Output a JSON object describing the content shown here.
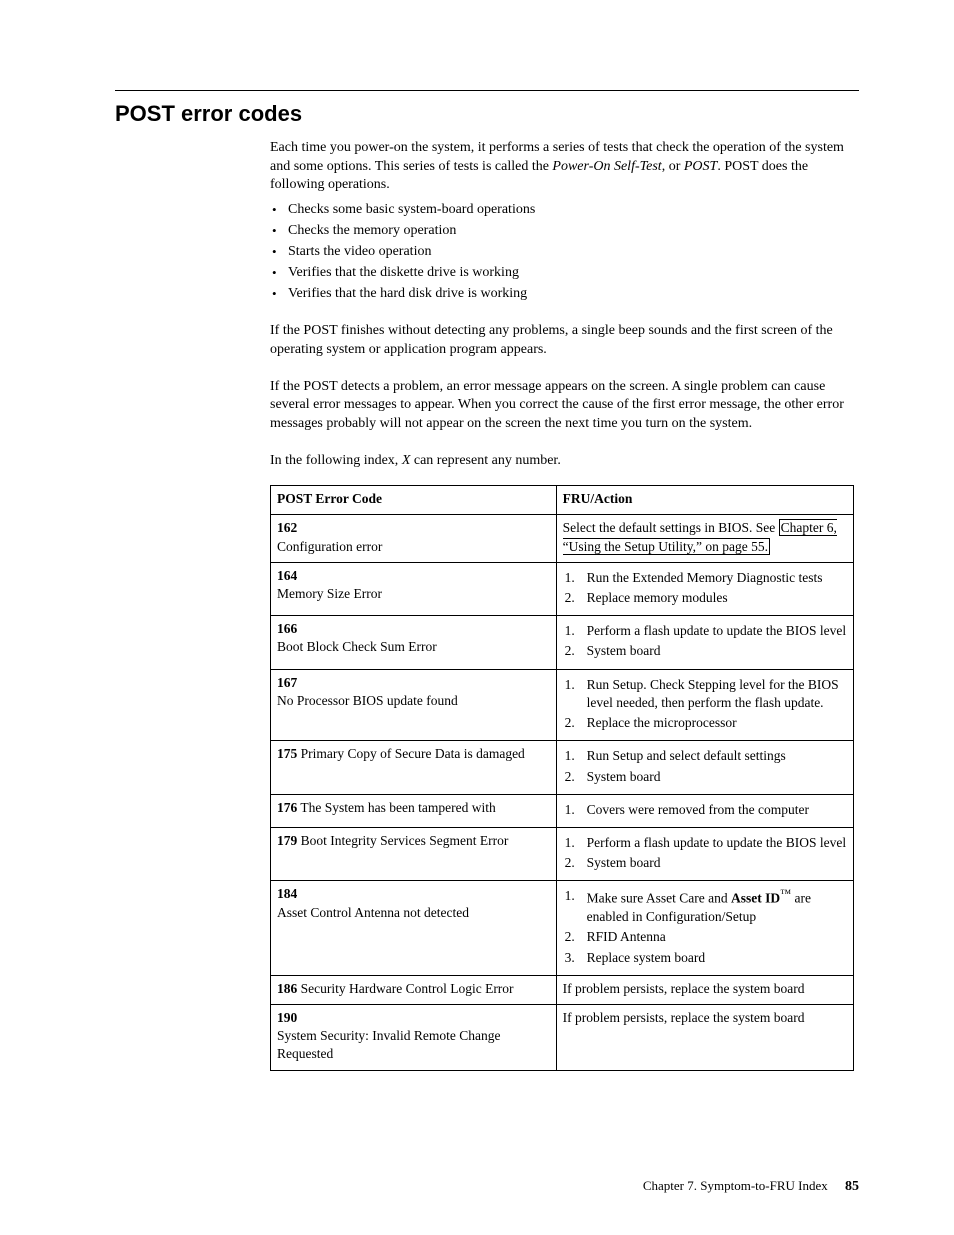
{
  "section_title": "POST error codes",
  "intro": {
    "p1a": "Each time you power-on the system, it performs a series of tests that check the operation of the system and some options. This series of tests is called the ",
    "p1_term1": "Power-On Self-Test",
    "p1_mid": ", or ",
    "p1_term2": "POST",
    "p1b": ". POST does the following operations.",
    "bullets": [
      "Checks some basic system-board operations",
      "Checks the memory operation",
      "Starts the video operation",
      "Verifies that the diskette drive is working",
      "Verifies that the hard disk drive is working"
    ],
    "p2": "If the POST finishes without detecting any problems, a single beep sounds and the first screen of the operating system or application program appears.",
    "p3": "If the POST detects a problem, an error message appears on the screen. A single problem can cause several error messages to appear. When you correct the cause of the first error message, the other error messages probably will not appear on the screen the next time you turn on the system.",
    "p4a": "In the following index, ",
    "p4_var": "X",
    "p4b": " can represent any number."
  },
  "table": {
    "headers": {
      "code": "POST Error Code",
      "action": "FRU/Action"
    },
    "rows": [
      {
        "code_num": "162",
        "code_desc": "Configuration error",
        "action_plain_pre": "Select the default settings in BIOS. See",
        "action_link": "Chapter 6, “Using the Setup Utility,” on page 55.",
        "steps": []
      },
      {
        "code_num": "164",
        "code_desc": "Memory Size Error",
        "steps": [
          "Run the Extended Memory Diagnostic tests",
          "Replace memory modules"
        ]
      },
      {
        "code_num": "166",
        "code_desc": "Boot Block Check Sum Error",
        "steps": [
          "Perform a flash update to update the BIOS level",
          "System board"
        ]
      },
      {
        "code_num": "167",
        "code_desc": "No Processor BIOS update found",
        "steps": [
          "Run Setup. Check Stepping level for the BIOS level needed, then perform the flash update.",
          "Replace the microprocessor"
        ]
      },
      {
        "code_num": "175",
        "code_desc_inline": "Primary Copy of Secure Data is damaged",
        "steps": [
          "Run Setup and select default settings",
          "System board"
        ]
      },
      {
        "code_num": "176",
        "code_desc_inline": "The System has been tampered with",
        "steps": [
          "Covers were removed from the computer"
        ]
      },
      {
        "code_num": "179",
        "code_desc_inline": "Boot Integrity Services Segment Error",
        "steps": [
          "Perform a flash update to update the BIOS level",
          "System board"
        ]
      },
      {
        "code_num": "184",
        "code_desc": "Asset Control Antenna not detected",
        "step1_pre": "Make sure Asset Care and ",
        "step1_bold": "Asset ID",
        "step1_tm": "™",
        "step1_post": " are enabled in Configuration/Setup",
        "extra_steps": [
          "RFID Antenna",
          "Replace system board"
        ]
      },
      {
        "code_num": "186",
        "code_desc_inline": "Security Hardware Control Logic Error",
        "action_plain": "If problem persists, replace the system board"
      },
      {
        "code_num": "190",
        "code_desc": "System Security: Invalid Remote Change Requested",
        "action_plain": "If problem persists, replace the system board"
      }
    ]
  },
  "footer": {
    "chapter": "Chapter 7. Symptom-to-FRU Index",
    "page": "85"
  }
}
